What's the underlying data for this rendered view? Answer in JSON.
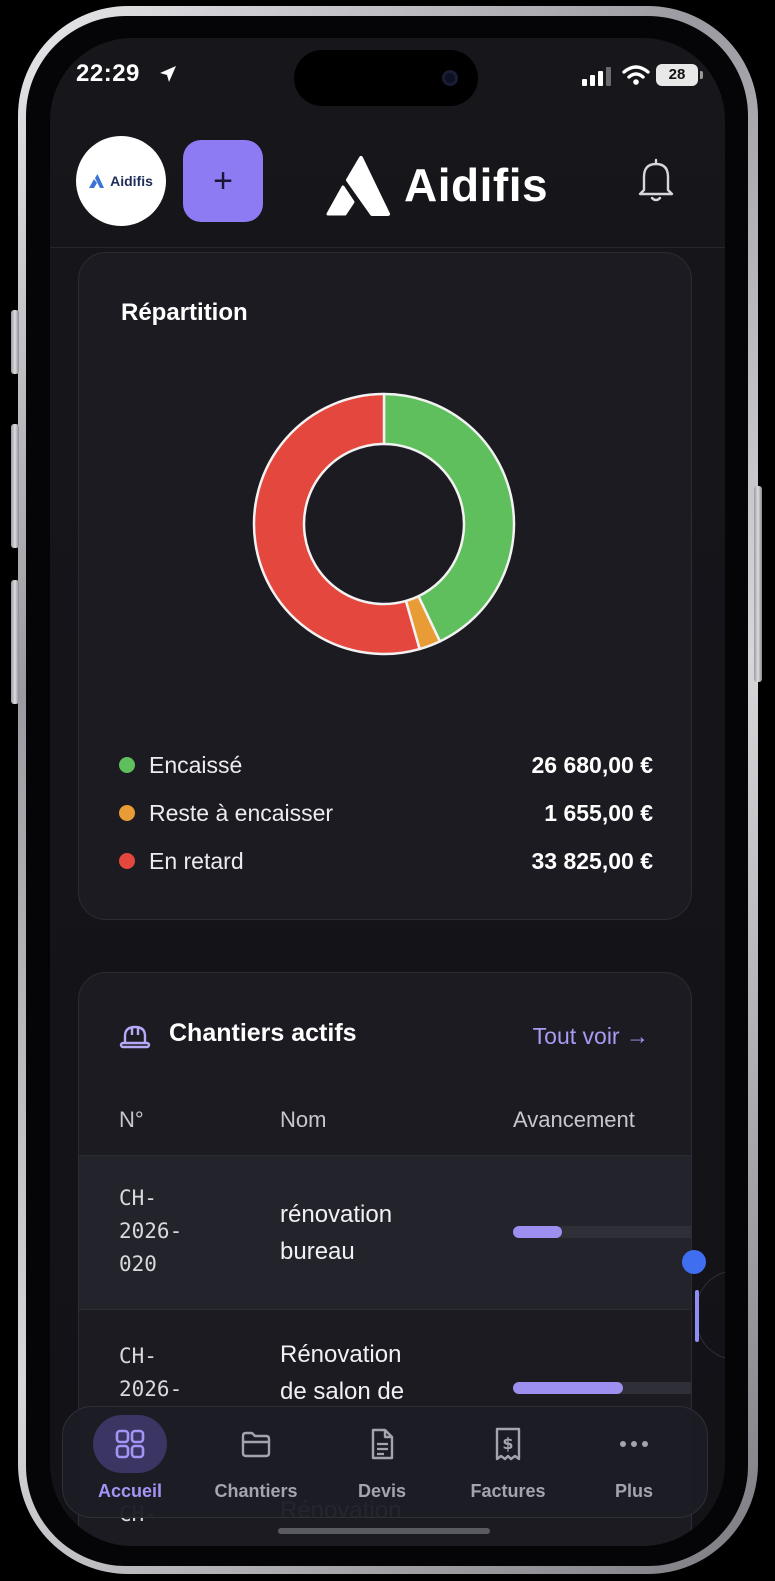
{
  "status_bar": {
    "time": "22:29",
    "battery": "28"
  },
  "header": {
    "avatar_text": "Aidifis",
    "add_label": "+",
    "brand": "Aidifis"
  },
  "repartition": {
    "title": "Répartition",
    "legend": [
      {
        "label": "Encaissé",
        "value": "26 680,00 €",
        "color": "#5fbf5c"
      },
      {
        "label": "Reste à encaisser",
        "value": "1 655,00 €",
        "color": "#e99b36"
      },
      {
        "label": "En retard",
        "value": "33 825,00 €",
        "color": "#e4473d"
      }
    ]
  },
  "chart_data": {
    "type": "pie",
    "title": "Répartition",
    "categories": [
      "Encaissé",
      "Reste à encaisser",
      "En retard"
    ],
    "values": [
      26680,
      1655,
      33825
    ],
    "colors": [
      "#5fbf5c",
      "#e99b36",
      "#e4473d"
    ],
    "donut": true,
    "legend": "bottom"
  },
  "chantiers": {
    "title": "Chantiers actifs",
    "link": "Tout voir →",
    "columns": {
      "num": "N°",
      "name": "Nom",
      "progress": "Avancement"
    },
    "rows": [
      {
        "num": "CH-\n2026-\n020",
        "name": "rénovation\nbureau",
        "progress": 0.26
      },
      {
        "num": "CH-\n2026-",
        "name": "Rénovation\nde salon de",
        "progress": 0.58
      },
      {
        "num": "CH-",
        "name": "Rénovation"
      }
    ]
  },
  "nav": {
    "items": [
      {
        "label": "Accueil",
        "icon": "grid-icon",
        "active": true
      },
      {
        "label": "Chantiers",
        "icon": "folder-icon"
      },
      {
        "label": "Devis",
        "icon": "document-icon"
      },
      {
        "label": "Factures",
        "icon": "invoice-icon"
      },
      {
        "label": "Plus",
        "icon": "more-icon"
      }
    ]
  }
}
